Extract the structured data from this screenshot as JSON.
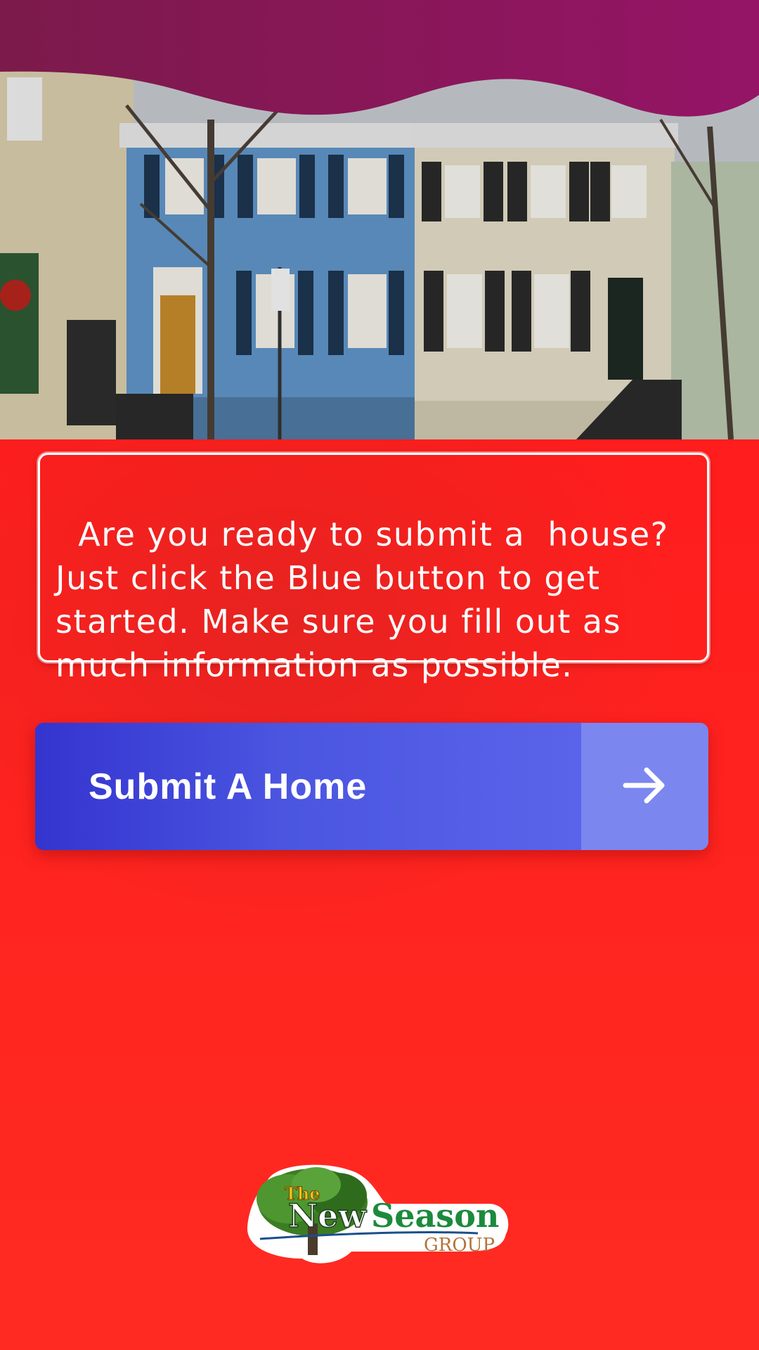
{
  "hero": {
    "image": "row-houses-photo",
    "wave_color": "#8a1658"
  },
  "message": {
    "text": "Are you ready to submit a  house? Just click the Blue button to get started. Make sure you fill out as much information as possible."
  },
  "submit": {
    "label": "Submit A Home",
    "icon": "arrow-right-icon",
    "color": "#4a55e0",
    "arrow_zone_color": "#7b86ef"
  },
  "logo": {
    "the": "The",
    "new": "New",
    "season": "Season",
    "group": "GROUP"
  },
  "colors": {
    "background": "#ff2a22",
    "text": "#ffffff"
  }
}
